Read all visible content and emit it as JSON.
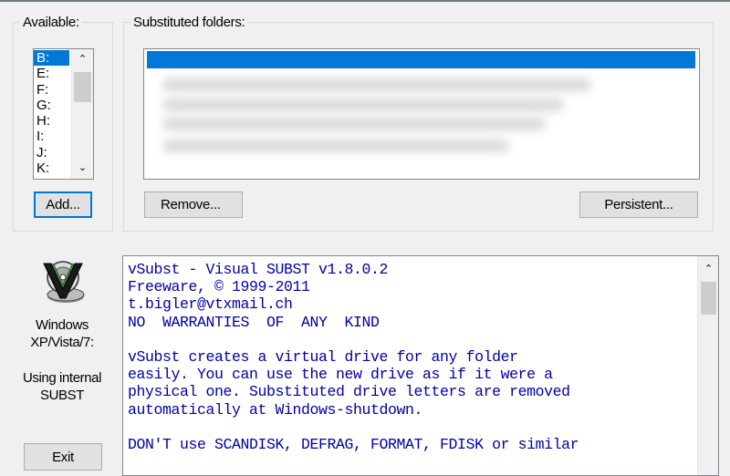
{
  "available": {
    "legend": "Available:",
    "drives": [
      "B:",
      "E:",
      "F:",
      "G:",
      "H:",
      "I:",
      "J:",
      "K:"
    ],
    "selected_index": 0,
    "add_label": "Add..."
  },
  "substituted": {
    "legend": "Substituted folders:",
    "remove_label": "Remove...",
    "persistent_label": "Persistent..."
  },
  "sidebar": {
    "os_line1": "Windows",
    "os_line2": "XP/Vista/7:",
    "subst_line1": "Using internal",
    "subst_line2": "SUBST",
    "exit_label": "Exit"
  },
  "about": {
    "lines": [
      "vSubst - Visual SUBST v1.8.0.2",
      "Freeware, © 1999-2011",
      "t.bigler@vtxmail.ch",
      "NO  WARRANTIES  OF  ANY  KIND",
      "",
      "vSubst creates a virtual drive for any folder",
      "easily. You can use the new drive as if it were a",
      "physical one. Substituted drive letters are removed",
      "automatically at Windows-shutdown.",
      "",
      "DON'T use SCANDISK, DEFRAG, FORMAT, FDISK or similar"
    ]
  },
  "colors": {
    "selection": "#0078d7",
    "about_text": "#0000a8",
    "window_bg": "#f0f0f0"
  }
}
